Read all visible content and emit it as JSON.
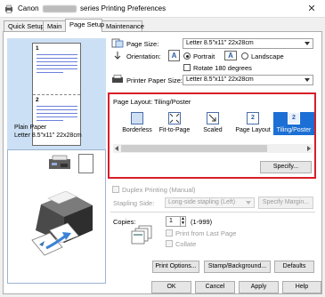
{
  "window": {
    "title_left": "Canon",
    "title_right": "series Printing Preferences",
    "close_glyph": "✕"
  },
  "tabs": [
    {
      "label": "Quick Setup"
    },
    {
      "label": "Main"
    },
    {
      "label": "Page Setup"
    },
    {
      "label": "Maintenance"
    }
  ],
  "preview": {
    "page1": "1",
    "page2": "2",
    "media_line1": "Plain Paper",
    "media_line2": "Letter 8.5\"x11\" 22x28cm"
  },
  "page_size": {
    "label": "Page Size:",
    "value": "Letter 8.5\"x11\" 22x28cm"
  },
  "orientation": {
    "label": "Orientation:",
    "portrait": "Portrait",
    "landscape": "Landscape",
    "selected": "Portrait",
    "rotate_label": "Rotate 180 degrees"
  },
  "printer_paper_size": {
    "label": "Printer Paper Size:",
    "value": "Letter 8.5\"x11\" 22x28cm"
  },
  "page_layout": {
    "label": "Page Layout:",
    "current": "Tiling/Poster",
    "options": [
      {
        "label": "Borderless",
        "selected": false
      },
      {
        "label": "Fit-to-Page",
        "selected": false
      },
      {
        "label": "Scaled",
        "selected": false
      },
      {
        "label": "Page Layout",
        "selected": false
      },
      {
        "label": "Tiling/Poster",
        "selected": true
      }
    ],
    "specify_button": "Specify..."
  },
  "duplex": {
    "label": "Duplex Printing (Manual)",
    "stapling_label": "Stapling Side:",
    "stapling_value": "Long-side stapling (Left)",
    "margin_button": "Specify Margin..."
  },
  "copies": {
    "label": "Copies:",
    "value": "1",
    "range": "(1-999)",
    "print_from_last": "Print from Last Page",
    "collate": "Collate"
  },
  "buttons": {
    "print_options": "Print Options...",
    "stamp_background": "Stamp/Background...",
    "defaults": "Defaults",
    "ok": "OK",
    "cancel": "Cancel",
    "apply": "Apply",
    "help": "Help"
  },
  "colors": {
    "highlight_box": "#d81e28",
    "selection_blue": "#1c6fd4",
    "preview_bg": "#cce0f5"
  }
}
